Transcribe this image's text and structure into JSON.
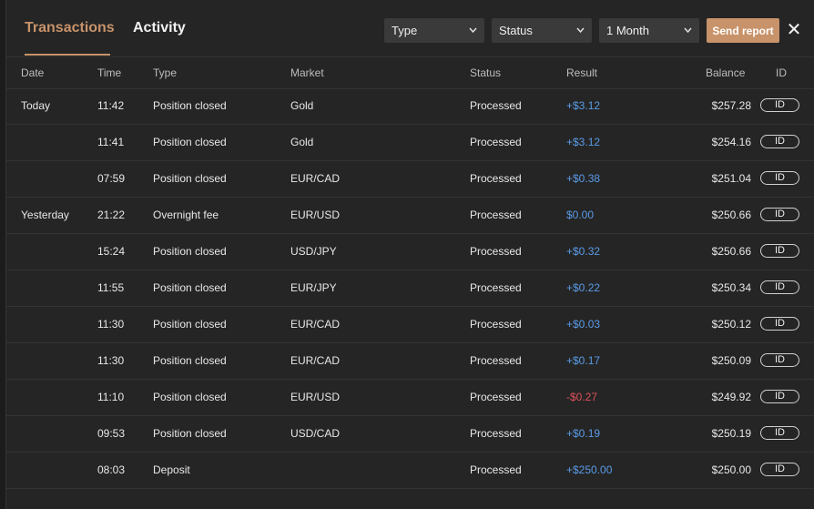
{
  "tabs": [
    {
      "label": "Transactions",
      "active": true
    },
    {
      "label": "Activity",
      "active": false
    }
  ],
  "filters": {
    "type": "Type",
    "status": "Status",
    "period": "1 Month"
  },
  "actions": {
    "send_report": "Send report",
    "close": "✕"
  },
  "columns": {
    "date": "Date",
    "time": "Time",
    "type": "Type",
    "market": "Market",
    "status": "Status",
    "result": "Result",
    "balance": "Balance",
    "id": "ID"
  },
  "colors": {
    "accent": "#c8936a",
    "positive": "#5a9be6",
    "negative": "#e0505a"
  },
  "rows": [
    {
      "date": "Today",
      "time": "11:42",
      "type": "Position closed",
      "market": "Gold",
      "status": "Processed",
      "result": "+$3.12",
      "sign": "pos",
      "balance": "$257.28",
      "id_label": "ID"
    },
    {
      "date": "",
      "time": "11:41",
      "type": "Position closed",
      "market": "Gold",
      "status": "Processed",
      "result": "+$3.12",
      "sign": "pos",
      "balance": "$254.16",
      "id_label": "ID"
    },
    {
      "date": "",
      "time": "07:59",
      "type": "Position closed",
      "market": "EUR/CAD",
      "status": "Processed",
      "result": "+$0.38",
      "sign": "pos",
      "balance": "$251.04",
      "id_label": "ID"
    },
    {
      "date": "Yesterday",
      "time": "21:22",
      "type": "Overnight fee",
      "market": "EUR/USD",
      "status": "Processed",
      "result": "$0.00",
      "sign": "neu",
      "balance": "$250.66",
      "id_label": "ID"
    },
    {
      "date": "",
      "time": "15:24",
      "type": "Position closed",
      "market": "USD/JPY",
      "status": "Processed",
      "result": "+$0.32",
      "sign": "pos",
      "balance": "$250.66",
      "id_label": "ID"
    },
    {
      "date": "",
      "time": "11:55",
      "type": "Position closed",
      "market": "EUR/JPY",
      "status": "Processed",
      "result": "+$0.22",
      "sign": "pos",
      "balance": "$250.34",
      "id_label": "ID"
    },
    {
      "date": "",
      "time": "11:30",
      "type": "Position closed",
      "market": "EUR/CAD",
      "status": "Processed",
      "result": "+$0.03",
      "sign": "pos",
      "balance": "$250.12",
      "id_label": "ID"
    },
    {
      "date": "",
      "time": "11:30",
      "type": "Position closed",
      "market": "EUR/CAD",
      "status": "Processed",
      "result": "+$0.17",
      "sign": "pos",
      "balance": "$250.09",
      "id_label": "ID"
    },
    {
      "date": "",
      "time": "11:10",
      "type": "Position closed",
      "market": "EUR/USD",
      "status": "Processed",
      "result": "-$0.27",
      "sign": "neg",
      "balance": "$249.92",
      "id_label": "ID"
    },
    {
      "date": "",
      "time": "09:53",
      "type": "Position closed",
      "market": "USD/CAD",
      "status": "Processed",
      "result": "+$0.19",
      "sign": "pos",
      "balance": "$250.19",
      "id_label": "ID"
    },
    {
      "date": "",
      "time": "08:03",
      "type": "Deposit",
      "market": "",
      "status": "Processed",
      "result": "+$250.00",
      "sign": "pos",
      "balance": "$250.00",
      "id_label": "ID"
    }
  ]
}
